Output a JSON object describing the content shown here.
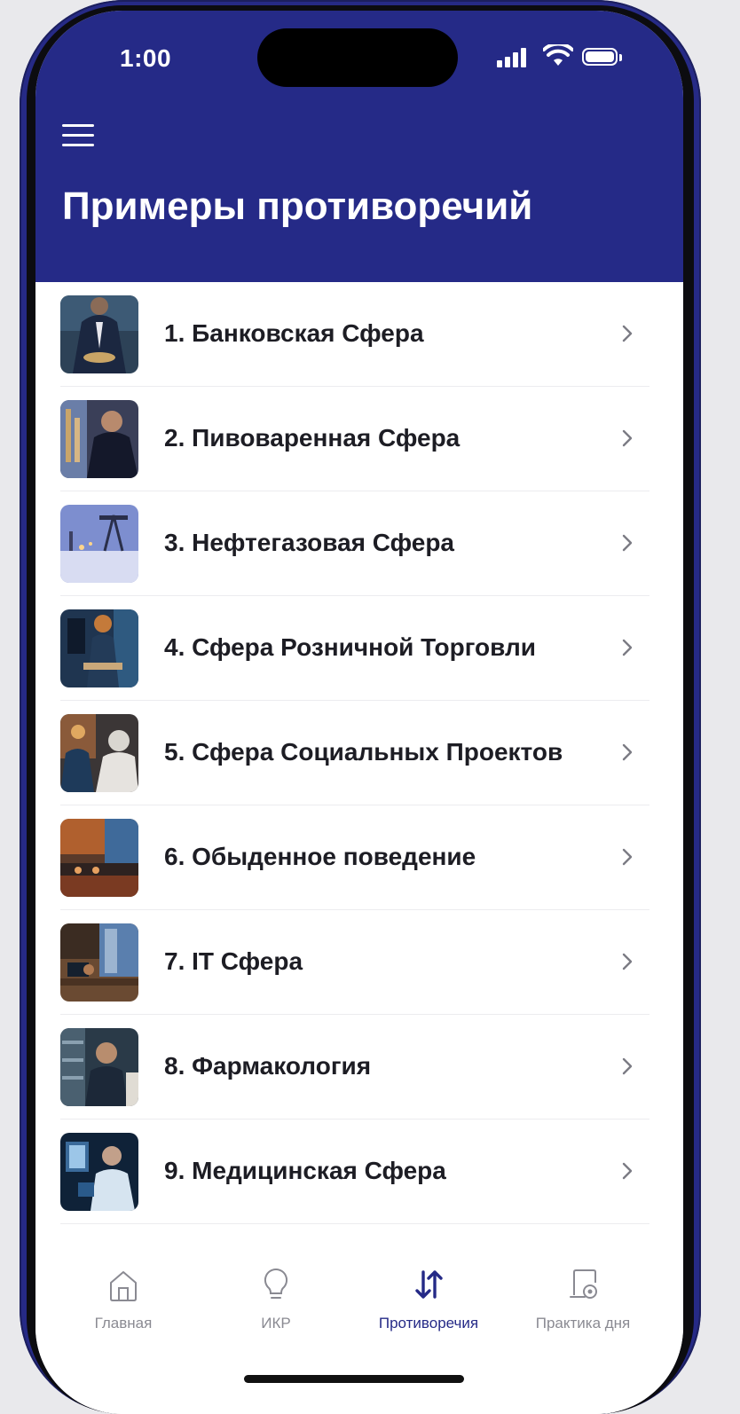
{
  "status_bar": {
    "time": "1:00",
    "icons": [
      "signal-icon",
      "wifi-icon",
      "battery-icon"
    ]
  },
  "header": {
    "menu_icon": "hamburger-menu-icon",
    "title": "Примеры противоречий",
    "background_color": "#252a87"
  },
  "list": {
    "items": [
      {
        "label": "1. Банковская Сфера",
        "thumbnail": "banking-photo"
      },
      {
        "label": "2. Пивоваренная Сфера",
        "thumbnail": "brewing-photo"
      },
      {
        "label": "3. Нефтегазовая Сфера",
        "thumbnail": "oil-gas-photo"
      },
      {
        "label": "4. Сфера Розничной Торговли",
        "thumbnail": "retail-photo"
      },
      {
        "label": "5. Сфера Социальных Проектов",
        "thumbnail": "social-projects-photo"
      },
      {
        "label": "6. Обыденное поведение",
        "thumbnail": "everyday-behavior-photo"
      },
      {
        "label": "7. IT Сфера",
        "thumbnail": "it-office-photo"
      },
      {
        "label": "8. Фармакология",
        "thumbnail": "pharmacology-photo"
      },
      {
        "label": "9. Медицинская Сфера",
        "thumbnail": "medical-photo"
      }
    ]
  },
  "tabbar": {
    "active_color": "#252a87",
    "inactive_color": "#8a8a92",
    "tabs": [
      {
        "label": "Главная",
        "icon": "home-icon",
        "active": false
      },
      {
        "label": "ИКР",
        "icon": "lightbulb-icon",
        "active": false
      },
      {
        "label": "Противоречия",
        "icon": "swap-arrows-icon",
        "active": true
      },
      {
        "label": "Практика дня",
        "icon": "practice-device-icon",
        "active": false
      }
    ]
  }
}
